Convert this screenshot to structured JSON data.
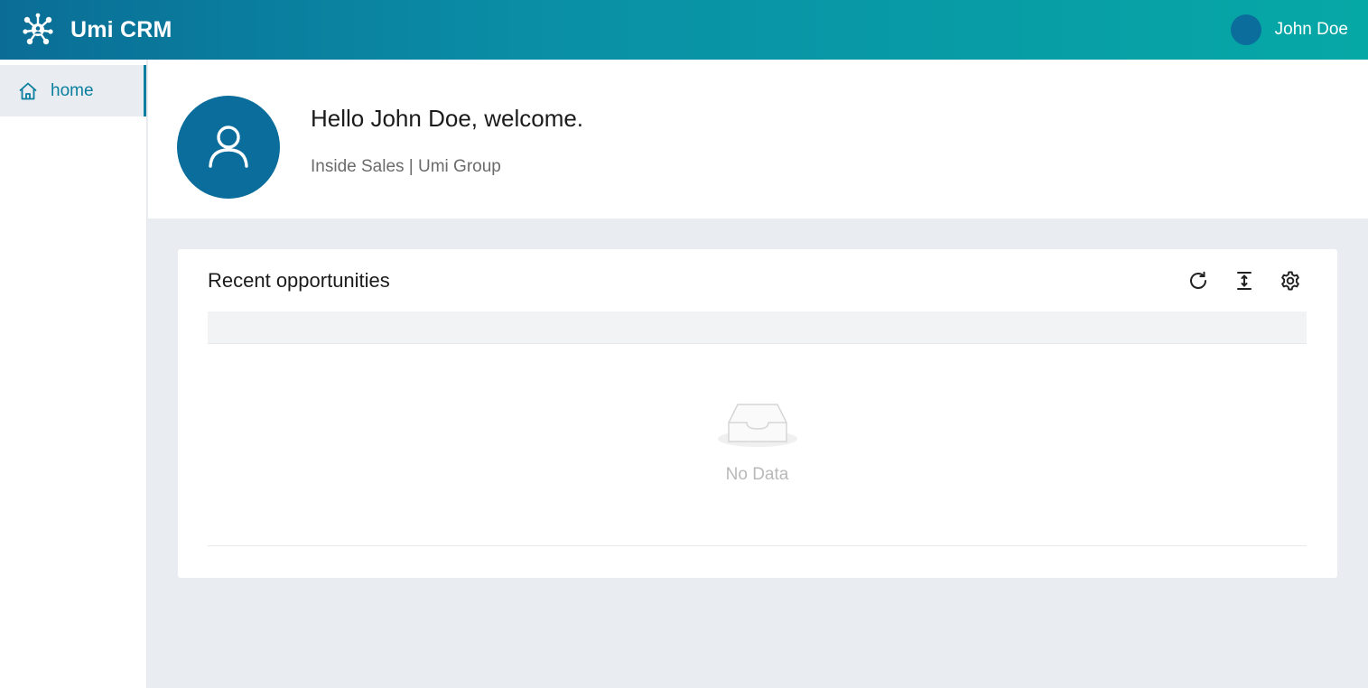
{
  "header": {
    "app_title": "Umi CRM",
    "logo_icon": "network-logo-icon",
    "user": {
      "name": "John Doe"
    }
  },
  "sidebar": {
    "items": [
      {
        "label": "home",
        "icon": "home-icon",
        "active": true
      }
    ]
  },
  "welcome": {
    "greeting": "Hello John Doe, welcome.",
    "subtitle": "Inside Sales | Umi Group"
  },
  "opportunities": {
    "title": "Recent opportunities",
    "toolbar": [
      "refresh-icon",
      "column-height-icon",
      "settings-icon"
    ],
    "empty_text": "No Data"
  },
  "colors": {
    "brand_dark": "#0b6d9b",
    "brand_teal": "#06a8a6",
    "active_text": "#0a7f9f",
    "page_bg": "#e9ecf0"
  }
}
